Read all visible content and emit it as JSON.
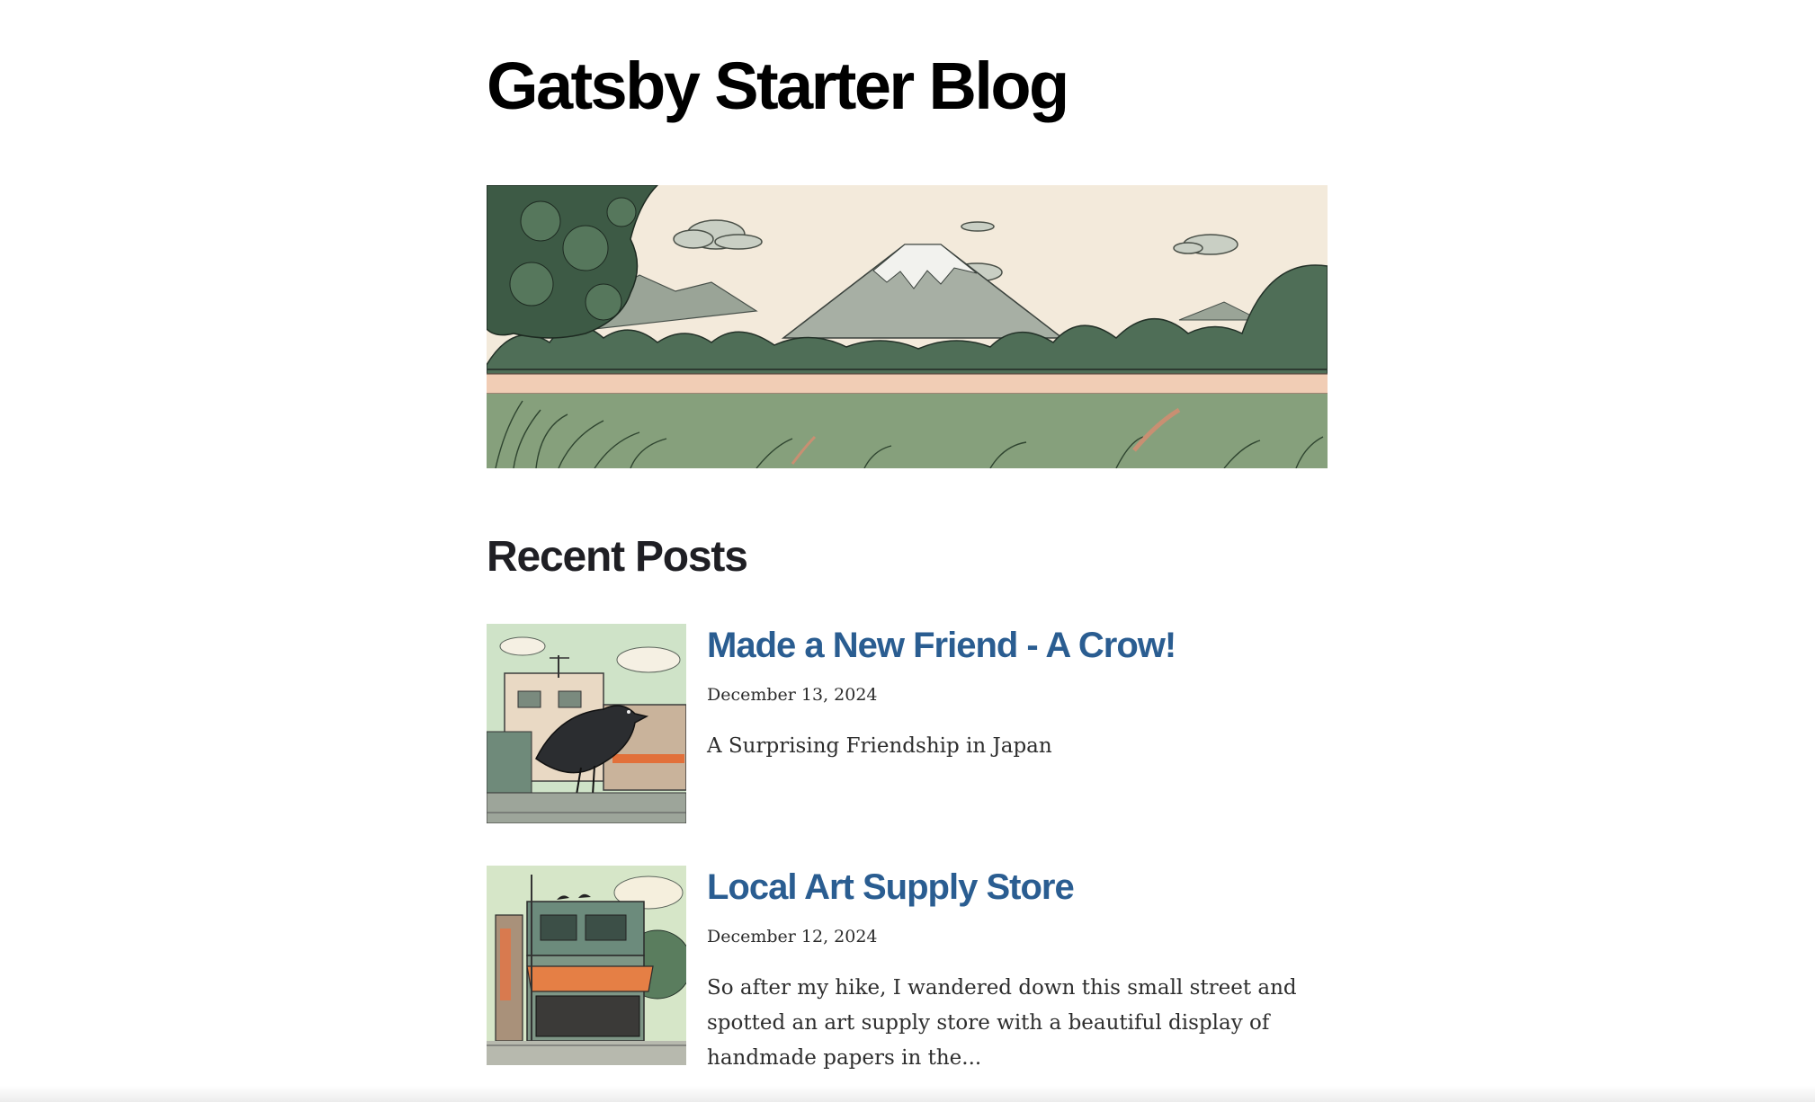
{
  "site": {
    "title": "Gatsby Starter Blog"
  },
  "hero": {
    "icon": "mountain-landscape-image"
  },
  "recent": {
    "heading": "Recent Posts",
    "posts": [
      {
        "title": "Made a New Friend - A Crow!",
        "date": "December 13, 2024",
        "description": "A Surprising Friendship in Japan",
        "thumbnail_icon": "crow-on-street-image"
      },
      {
        "title": "Local Art Supply Store",
        "date": "December 12, 2024",
        "description": "So after my hike, I wandered down this small street and spotted an art supply store with a beautiful display of handmade papers in the...",
        "thumbnail_icon": "art-supply-storefront-image"
      }
    ]
  },
  "colors": {
    "link": "#2a5d91",
    "heading": "#000000",
    "sky": "#f2e9d8",
    "grass": "#7f9a72"
  }
}
